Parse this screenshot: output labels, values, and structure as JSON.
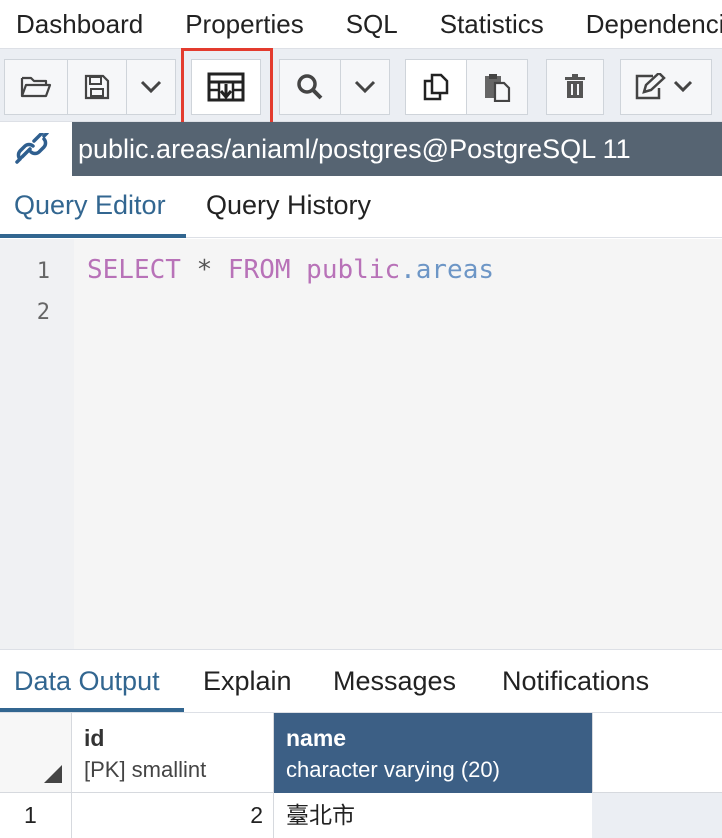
{
  "top_tabs": [
    "Dashboard",
    "Properties",
    "SQL",
    "Statistics",
    "Dependencies"
  ],
  "toolbar": {
    "buttons": [
      {
        "name": "open-file-button",
        "icon": "folder-open-icon"
      },
      {
        "name": "save-file-button",
        "icon": "floppy-icon"
      },
      {
        "name": "save-dropdown-button",
        "icon": "chevron-down-icon"
      },
      {
        "name": "save-results-to-file-button",
        "icon": "download-table-icon",
        "highlighted": true
      },
      {
        "name": "find-button",
        "icon": "search-icon"
      },
      {
        "name": "find-dropdown-button",
        "icon": "chevron-down-icon"
      },
      {
        "name": "copy-button",
        "icon": "copy-icon"
      },
      {
        "name": "paste-button",
        "icon": "paste-icon"
      },
      {
        "name": "delete-button",
        "icon": "trash-icon"
      },
      {
        "name": "edit-dropdown-button",
        "icon": "edit-icon"
      }
    ],
    "highlight_color": "#e33b2e"
  },
  "connection": {
    "label": "public.areas/aniaml/postgres@PostgreSQL 11",
    "icon": "connection-link-icon"
  },
  "editor_tabs": [
    "Query Editor",
    "Query History"
  ],
  "editor": {
    "line_numbers": [
      "1",
      "2"
    ],
    "tokens": {
      "select": "SELECT",
      "star": " * ",
      "from": "FROM",
      "schema": "public",
      "dot_table": ".areas"
    }
  },
  "output_tabs": [
    "Data Output",
    "Explain",
    "Messages",
    "Notifications"
  ],
  "grid": {
    "columns": [
      {
        "title": "id",
        "type": "[PK] smallint"
      },
      {
        "title": "name",
        "type": "character varying (20)"
      }
    ],
    "rows": [
      {
        "row_num": "1",
        "id": "2",
        "name": "臺北市"
      }
    ]
  },
  "colors": {
    "accent": "#326690",
    "connection_bar": "#566472",
    "selected_header": "#3c5f85"
  }
}
